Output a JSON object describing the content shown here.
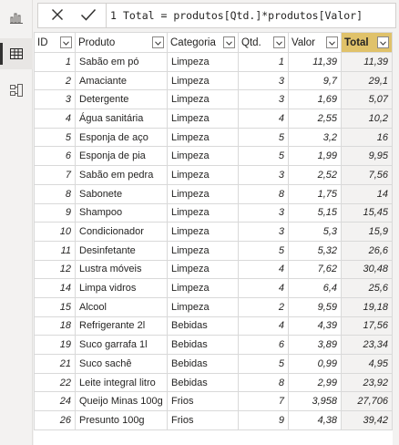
{
  "formula": {
    "line_number": "1",
    "text": "Total = produtos[Qtd.]*produtos[Valor]"
  },
  "rail": {
    "items": [
      {
        "icon": "report-view-icon"
      },
      {
        "icon": "data-view-icon"
      },
      {
        "icon": "model-view-icon"
      }
    ]
  },
  "table": {
    "columns": [
      {
        "label": "ID"
      },
      {
        "label": "Produto"
      },
      {
        "label": "Categoria"
      },
      {
        "label": "Qtd."
      },
      {
        "label": "Valor"
      },
      {
        "label": "Total"
      }
    ],
    "rows": [
      {
        "id": "1",
        "produto": "Sabão em pó",
        "categoria": "Limpeza",
        "qtd": "1",
        "valor": "11,39",
        "total": "11,39"
      },
      {
        "id": "2",
        "produto": "Amaciante",
        "categoria": "Limpeza",
        "qtd": "3",
        "valor": "9,7",
        "total": "29,1"
      },
      {
        "id": "3",
        "produto": "Detergente",
        "categoria": "Limpeza",
        "qtd": "3",
        "valor": "1,69",
        "total": "5,07"
      },
      {
        "id": "4",
        "produto": "Água sanitária",
        "categoria": "Limpeza",
        "qtd": "4",
        "valor": "2,55",
        "total": "10,2"
      },
      {
        "id": "5",
        "produto": "Esponja de aço",
        "categoria": "Limpeza",
        "qtd": "5",
        "valor": "3,2",
        "total": "16"
      },
      {
        "id": "6",
        "produto": "Esponja de pia",
        "categoria": "Limpeza",
        "qtd": "5",
        "valor": "1,99",
        "total": "9,95"
      },
      {
        "id": "7",
        "produto": "Sabão em pedra",
        "categoria": "Limpeza",
        "qtd": "3",
        "valor": "2,52",
        "total": "7,56"
      },
      {
        "id": "8",
        "produto": "Sabonete",
        "categoria": "Limpeza",
        "qtd": "8",
        "valor": "1,75",
        "total": "14"
      },
      {
        "id": "9",
        "produto": "Shampoo",
        "categoria": "Limpeza",
        "qtd": "3",
        "valor": "5,15",
        "total": "15,45"
      },
      {
        "id": "10",
        "produto": "Condicionador",
        "categoria": "Limpeza",
        "qtd": "3",
        "valor": "5,3",
        "total": "15,9"
      },
      {
        "id": "11",
        "produto": "Desinfetante",
        "categoria": "Limpeza",
        "qtd": "5",
        "valor": "5,32",
        "total": "26,6"
      },
      {
        "id": "12",
        "produto": "Lustra móveis",
        "categoria": "Limpeza",
        "qtd": "4",
        "valor": "7,62",
        "total": "30,48"
      },
      {
        "id": "14",
        "produto": "Limpa vidros",
        "categoria": "Limpeza",
        "qtd": "4",
        "valor": "6,4",
        "total": "25,6"
      },
      {
        "id": "15",
        "produto": "Alcool",
        "categoria": "Limpeza",
        "qtd": "2",
        "valor": "9,59",
        "total": "19,18"
      },
      {
        "id": "18",
        "produto": "Refrigerante 2l",
        "categoria": "Bebidas",
        "qtd": "4",
        "valor": "4,39",
        "total": "17,56"
      },
      {
        "id": "19",
        "produto": "Suco garrafa 1l",
        "categoria": "Bebidas",
        "qtd": "6",
        "valor": "3,89",
        "total": "23,34"
      },
      {
        "id": "21",
        "produto": "Suco sachê",
        "categoria": "Bebidas",
        "qtd": "5",
        "valor": "0,99",
        "total": "4,95"
      },
      {
        "id": "22",
        "produto": "Leite integral litro",
        "categoria": "Bebidas",
        "qtd": "8",
        "valor": "2,99",
        "total": "23,92"
      },
      {
        "id": "24",
        "produto": "Queijo Minas 100g",
        "categoria": "Frios",
        "qtd": "7",
        "valor": "3,958",
        "total": "27,706"
      },
      {
        "id": "26",
        "produto": "Presunto 100g",
        "categoria": "Frios",
        "qtd": "9",
        "valor": "4,38",
        "total": "39,42"
      }
    ]
  },
  "colors": {
    "total_header": "#e0c26a",
    "total_cell": "#f3f2f1",
    "grid": "#d9d9d9"
  }
}
